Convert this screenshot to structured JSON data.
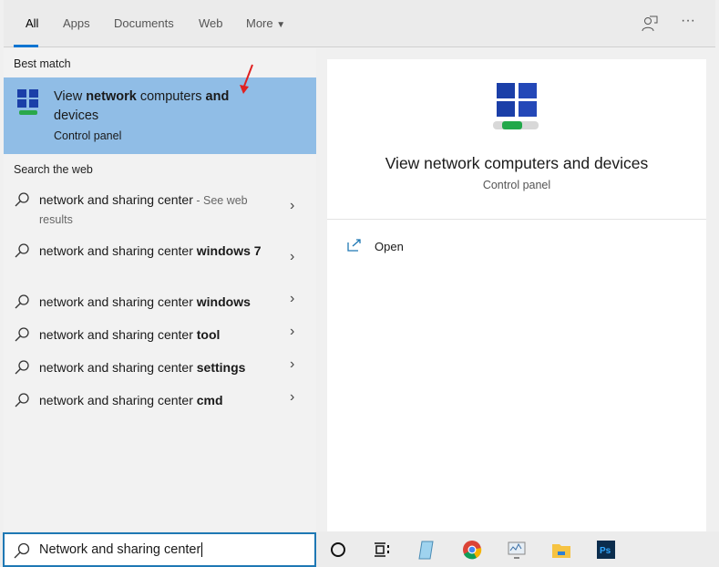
{
  "tabs": [
    {
      "label": "All",
      "active": true
    },
    {
      "label": "Apps"
    },
    {
      "label": "Documents"
    },
    {
      "label": "Web"
    },
    {
      "label": "More"
    }
  ],
  "header_icons": [
    "feedback-icon",
    "more-options-icon"
  ],
  "more_ellipsis": "···",
  "best_match": {
    "heading": "Best match",
    "title_parts": [
      "View ",
      "network",
      " computers ",
      "and"
    ],
    "title_line2": "devices",
    "subtitle": "Control panel"
  },
  "web": {
    "heading": "Search the web",
    "items": [
      {
        "normal": "network and sharing center",
        "bold": "",
        "suffix": " - See web results"
      },
      {
        "normal": "network and sharing center ",
        "bold": "windows 7",
        "suffix": ""
      },
      {
        "normal": "network and sharing center ",
        "bold": "windows",
        "suffix": ""
      },
      {
        "normal": "network and sharing center ",
        "bold": "tool",
        "suffix": ""
      },
      {
        "normal": "network and sharing center ",
        "bold": "settings",
        "suffix": ""
      },
      {
        "normal": "network and sharing center ",
        "bold": "cmd",
        "suffix": ""
      }
    ]
  },
  "preview": {
    "title": "View network computers and devices",
    "subtitle": "Control panel",
    "actions": [
      {
        "label": "Open",
        "icon": "open-icon"
      }
    ]
  },
  "search": {
    "value": "Network and sharing center"
  },
  "taskbar_icons": [
    "cortana-icon",
    "task-view-icon",
    "notepad-icon",
    "chrome-icon",
    "performance-monitor-icon",
    "file-explorer-icon",
    "photoshop-icon"
  ],
  "colors": {
    "accent": "#0a74d1",
    "selected": "#90bde6"
  }
}
